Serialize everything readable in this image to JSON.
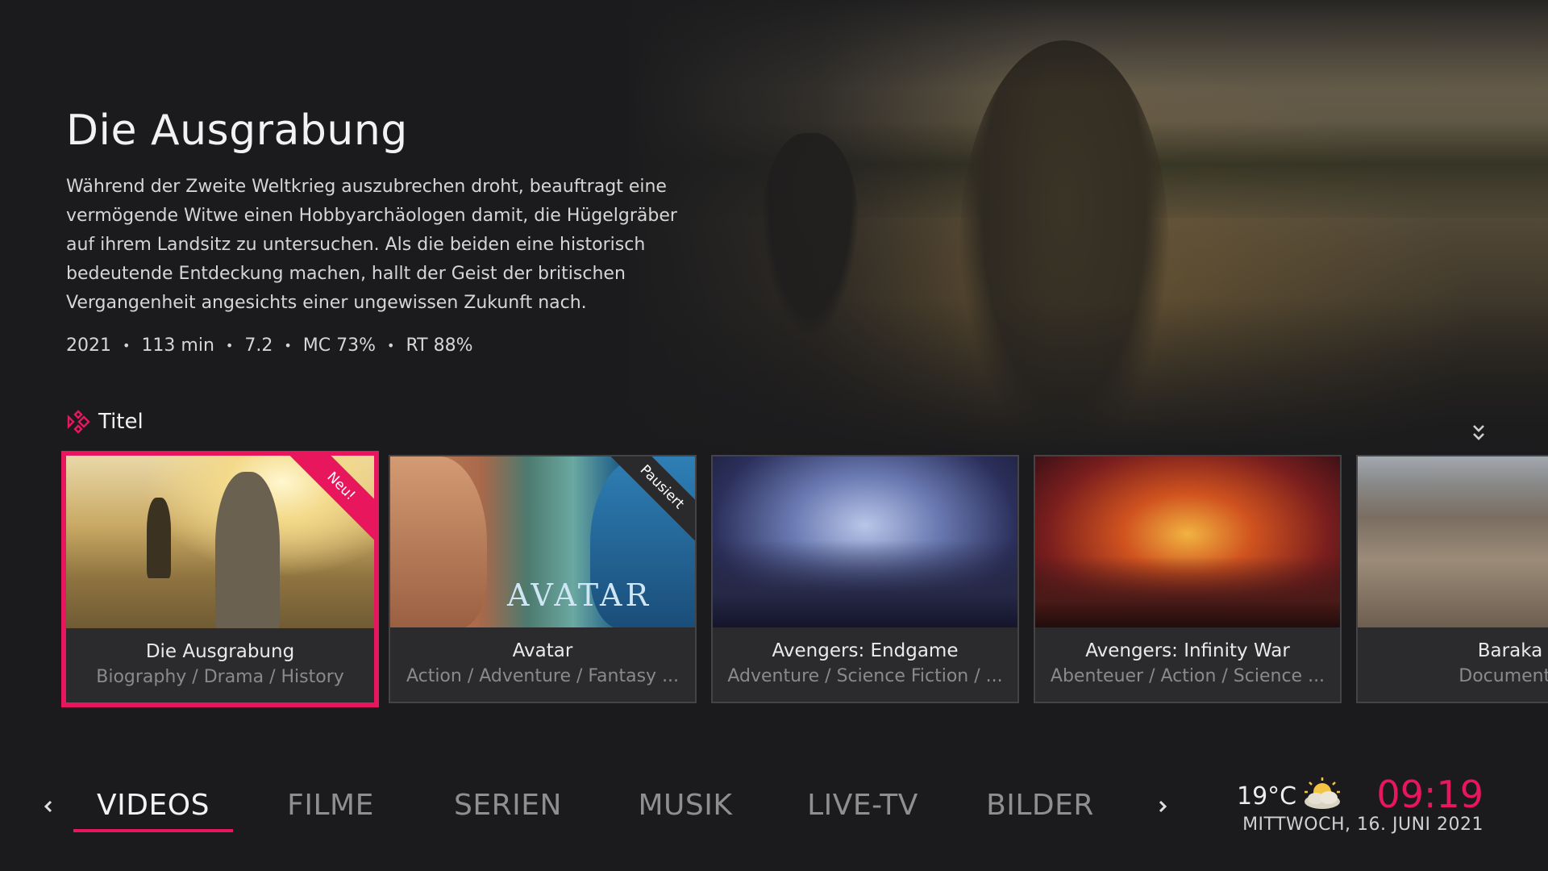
{
  "hero": {
    "title": "Die Ausgrabung",
    "plot": "Während der Zweite Weltkrieg auszubrechen droht, beauftragt eine vermögende Witwe einen Hobbyarchäologen damit, die Hügelgräber auf ihrem Landsitz zu untersuchen. Als die beiden eine historisch bedeutende Entdeckung machen, hallt der Geist der britischen Vergangenheit angesichts einer ungewissen Zukunft nach.",
    "meta": {
      "year": "2021",
      "runtime": "113 min",
      "rating": "7.2",
      "mc": "MC 73%",
      "rt": "RT 88%",
      "separator": "•"
    }
  },
  "section": {
    "label": "Titel",
    "icon": "kodi-logo-icon"
  },
  "cards": [
    {
      "title": "Die Ausgrabung",
      "genres": "Biography / Drama / History",
      "badge": "Neu!",
      "focused": true
    },
    {
      "title": "Avatar",
      "genres": "Action / Adventure / Fantasy ...",
      "badge": "Pausiert",
      "logo_text": "AVATAR"
    },
    {
      "title": "Avengers: Endgame",
      "genres": "Adventure / Science Fiction / ..."
    },
    {
      "title": "Avengers: Infinity War",
      "genres": "Abenteuer / Action / Science ..."
    },
    {
      "title": "Baraka",
      "genres": "Documenta"
    }
  ],
  "nav": {
    "items": [
      "VIDEOS",
      "FILME",
      "SERIEN",
      "MUSIK",
      "LIVE-TV",
      "BILDER"
    ],
    "active": "VIDEOS",
    "prev_icon": "chevron-left-icon",
    "next_icon": "chevron-right-icon"
  },
  "status": {
    "temperature": "19°C",
    "weather_icon": "partly-cloudy-icon",
    "time": "09:19",
    "date": "MITTWOCH, 16. JUNI 2021"
  },
  "colors": {
    "accent": "#e8175d",
    "background": "#1b1b1d",
    "card_bg": "#2b2b2d"
  }
}
